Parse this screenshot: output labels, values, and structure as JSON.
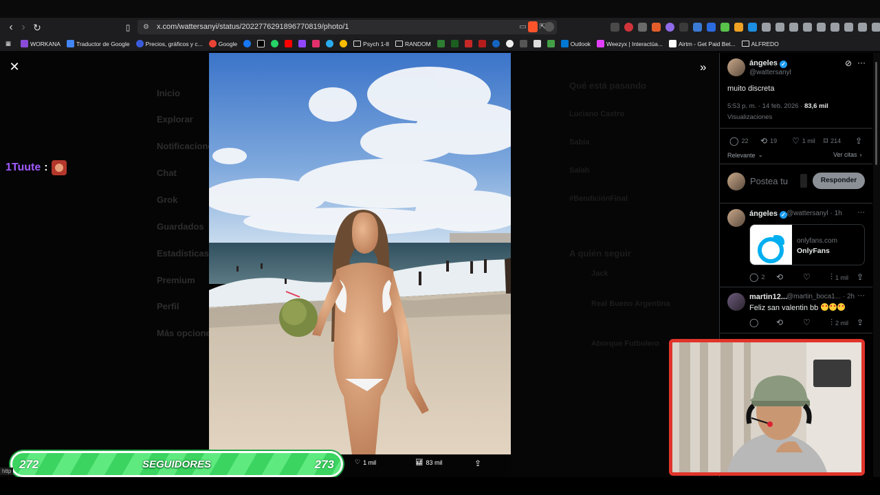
{
  "browser": {
    "url": "x.com/wattersanyi/status/2022776291896770819/photo/1",
    "bookmarks": [
      {
        "label": "WORKANA",
        "color": "#8a4bd8"
      },
      {
        "label": "Traductor de Google",
        "color": "#4285f4"
      },
      {
        "label": "Precios, gráficos y c...",
        "color": "#3a5bd9"
      },
      {
        "label": "Google",
        "color": "#ea4335"
      },
      {
        "label": "",
        "color": "#ffffff"
      },
      {
        "label": "",
        "color": "#1da1f2"
      },
      {
        "label": "",
        "color": "#000000"
      },
      {
        "label": "",
        "color": "#25d366"
      },
      {
        "label": "",
        "color": "#ff0000"
      },
      {
        "label": "",
        "color": "#9146ff"
      },
      {
        "label": "",
        "color": "#e1306c"
      },
      {
        "label": "",
        "color": "#2aabee"
      },
      {
        "label": "",
        "color": "#ffbb00"
      }
    ],
    "folders": [
      "Psych 1-8",
      "RANDOM"
    ],
    "bookmarks2": [
      "Outlook",
      "Weezyx | Interactúa...",
      "Airtm - Get Paid Bet...",
      "ALFREDO"
    ]
  },
  "stream": {
    "chat_user": "1Tuute",
    "chat_sep": ":",
    "follow_left": "272",
    "follow_label": "SEGUIDORES",
    "follow_right": "273",
    "status_url": "http"
  },
  "photo_bar": {
    "likes": "1 mil",
    "views": "83 mil"
  },
  "post": {
    "author": "ángeles",
    "handle": "@wattersanyl",
    "text": "muito discreta",
    "time": "5:53 p. m. · 14 feb. 2026 ·",
    "views_count": "83,6 mil",
    "views_label": "Visualizaciones",
    "replies": "22",
    "reposts": "19",
    "likes": "1 mil",
    "bookmarks": "214",
    "sort_label": "Relevante",
    "quotes_label": "Ver citas",
    "compose_placeholder": "Postea tu",
    "reply_button": "Responder"
  },
  "replies": [
    {
      "author": "ángeles",
      "handle": "@wattersanyl · 1h",
      "card_domain": "onlyfans.com",
      "card_name": "OnlyFans",
      "replies": "2",
      "views": "1 mil"
    },
    {
      "author": "martin12...",
      "handle": "@martin_boca1... · 2h",
      "text": "Feliz san valentin bb",
      "views": "2 mil"
    }
  ],
  "dim_sidebar": [
    "Inicio",
    "Explorar",
    "Notificaciones",
    "Chat",
    "Grok",
    "Guardados",
    "Estadísticas",
    "Premium",
    "Perfil",
    "Más opciones"
  ],
  "dim_trends": [
    "Qué está pasando",
    "Luciano Castro",
    "Sabia",
    "Salah",
    "#BendiciónFinal"
  ],
  "dim_follow": [
    "A quién seguir",
    "Jack",
    "Real Bueno Argentina",
    "Aborque Futbolero"
  ],
  "colors": {
    "accent": "#1d9bf0",
    "follow_green": "#3bd460",
    "webcam_border": "#e0352b",
    "chat_name": "#a15bff"
  }
}
